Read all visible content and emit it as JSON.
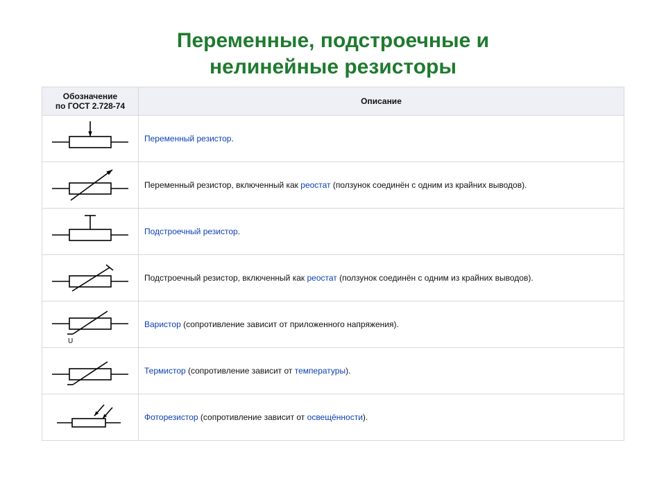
{
  "title_line1": "Переменные, подстроечные и",
  "title_line2": "нелинейные резисторы",
  "header": {
    "col1_line1": "Обозначение",
    "col1_line2": "по ГОСТ 2.728-74",
    "col2": "Описание"
  },
  "rows": [
    {
      "sym": "variable-resistor",
      "desc": [
        {
          "t": "link",
          "text": "Переменный резистор"
        },
        {
          "t": "text",
          "text": "."
        }
      ]
    },
    {
      "sym": "variable-resistor-rheostat",
      "desc": [
        {
          "t": "text",
          "text": "Переменный резистор, включенный как "
        },
        {
          "t": "link",
          "text": "реостат"
        },
        {
          "t": "text",
          "text": " (ползунок соединён с одним из крайних выводов)."
        }
      ]
    },
    {
      "sym": "trimmer-resistor",
      "desc": [
        {
          "t": "link",
          "text": "Подстроечный резистор"
        },
        {
          "t": "text",
          "text": "."
        }
      ]
    },
    {
      "sym": "trimmer-resistor-rheostat",
      "desc": [
        {
          "t": "text",
          "text": "Подстроечный резистор, включенный как "
        },
        {
          "t": "link",
          "text": "реостат"
        },
        {
          "t": "text",
          "text": " (ползунок соединён с одним из крайних выводов)."
        }
      ]
    },
    {
      "sym": "varistor",
      "desc": [
        {
          "t": "link",
          "text": "Варистор"
        },
        {
          "t": "text",
          "text": " (сопротивление зависит от приложенного напряжения)."
        }
      ]
    },
    {
      "sym": "thermistor",
      "desc": [
        {
          "t": "link",
          "text": "Термистор"
        },
        {
          "t": "text",
          "text": " (сопротивление зависит от "
        },
        {
          "t": "link",
          "text": "температуры"
        },
        {
          "t": "text",
          "text": ")."
        }
      ]
    },
    {
      "sym": "photoresistor",
      "desc": [
        {
          "t": "link",
          "text": "Фоторезистор"
        },
        {
          "t": "text",
          "text": " (сопротивление зависит от "
        },
        {
          "t": "link",
          "text": "освещённости"
        },
        {
          "t": "text",
          "text": ")."
        }
      ]
    }
  ]
}
